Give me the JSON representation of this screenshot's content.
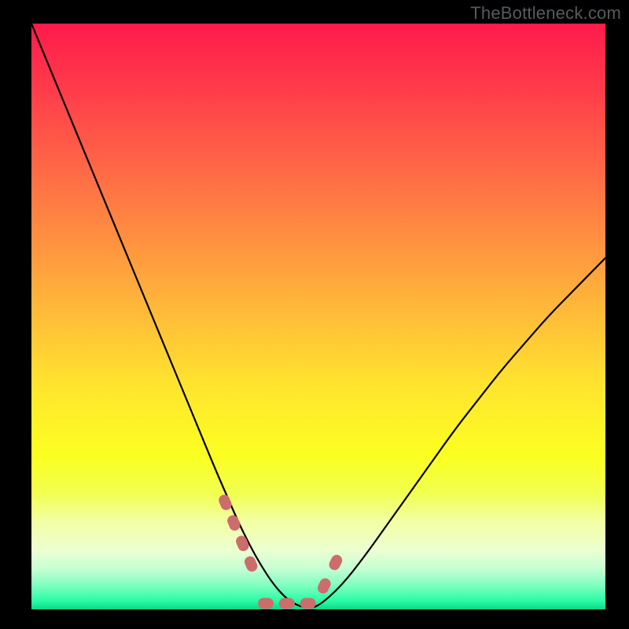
{
  "watermark": "TheBottleneck.com",
  "colors": {
    "frame": "#000000",
    "curve_stroke": "#000000",
    "marker_fill": "#cc6d6c",
    "gradient_stops": [
      {
        "offset": 0.0,
        "color": "#ff1a4b"
      },
      {
        "offset": 0.12,
        "color": "#ff3e4a"
      },
      {
        "offset": 0.25,
        "color": "#ff6946"
      },
      {
        "offset": 0.38,
        "color": "#ff9440"
      },
      {
        "offset": 0.5,
        "color": "#ffbd38"
      },
      {
        "offset": 0.62,
        "color": "#ffe52e"
      },
      {
        "offset": 0.74,
        "color": "#fbff21"
      },
      {
        "offset": 0.8,
        "color": "#f1ff4e"
      },
      {
        "offset": 0.85,
        "color": "#f3ffa4"
      },
      {
        "offset": 0.9,
        "color": "#ebffd1"
      },
      {
        "offset": 0.93,
        "color": "#c6ffd3"
      },
      {
        "offset": 0.96,
        "color": "#7cffbe"
      },
      {
        "offset": 0.985,
        "color": "#2bfca6"
      },
      {
        "offset": 1.0,
        "color": "#0bd888"
      }
    ]
  },
  "chart_data": {
    "type": "line",
    "title": "",
    "xlabel": "",
    "ylabel": "",
    "xlim": [
      0,
      100
    ],
    "ylim": [
      0,
      100
    ],
    "categories": [],
    "series": [
      {
        "name": "bottleneck-curve",
        "x": [
          0,
          4,
          8,
          12,
          16,
          20,
          24,
          28,
          32,
          34,
          36,
          38,
          40,
          42,
          44,
          46,
          48,
          50,
          54,
          58,
          62,
          66,
          70,
          74,
          78,
          82,
          86,
          90,
          94,
          98,
          100
        ],
        "y": [
          100,
          90.5,
          81,
          71.5,
          62,
          52.5,
          43,
          33.5,
          24,
          19.5,
          15,
          11,
          7.5,
          4.5,
          2.2,
          0.8,
          0.2,
          0.5,
          4,
          9,
          14.5,
          20,
          25.5,
          31,
          36,
          41,
          45.5,
          50,
          54,
          58,
          60
        ]
      }
    ],
    "trough_markers": {
      "left": {
        "x_start": 33,
        "x_end": 39,
        "y_start": 20,
        "y_end": 6
      },
      "floor": {
        "x_start": 39,
        "x_end": 50,
        "y": 1
      },
      "right": {
        "x_start": 50,
        "x_end": 54,
        "y_start": 2,
        "y_end": 10
      }
    }
  }
}
